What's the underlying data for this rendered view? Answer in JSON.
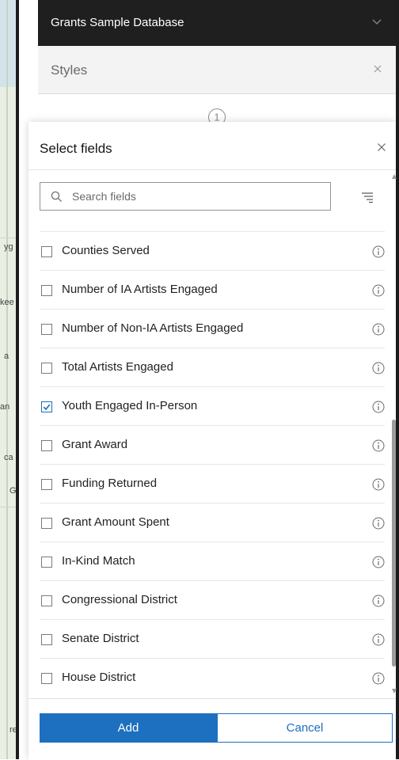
{
  "header": {
    "title": "Grants Sample Database",
    "chevron_icon": "chevron-down-icon"
  },
  "styles_panel": {
    "title": "Styles",
    "step_number": "1"
  },
  "map_labels": [
    "yg",
    "kee",
    "a",
    "an",
    "ca",
    "G",
    "re"
  ],
  "dialog": {
    "title": "Select fields",
    "search": {
      "placeholder": "Search fields",
      "value": ""
    },
    "fields": [
      {
        "label": "Counties Served",
        "checked": false
      },
      {
        "label": "Number of IA Artists Engaged",
        "checked": false
      },
      {
        "label": "Number of Non-IA Artists Engaged",
        "checked": false
      },
      {
        "label": "Total Artists Engaged",
        "checked": false
      },
      {
        "label": "Youth Engaged In-Person",
        "checked": true
      },
      {
        "label": "Grant Award",
        "checked": false
      },
      {
        "label": "Funding Returned",
        "checked": false
      },
      {
        "label": "Grant Amount Spent",
        "checked": false
      },
      {
        "label": "In-Kind Match",
        "checked": false
      },
      {
        "label": "Congressional District",
        "checked": false
      },
      {
        "label": "Senate District",
        "checked": false
      },
      {
        "label": "House District",
        "checked": false
      }
    ],
    "add_label": "Add",
    "cancel_label": "Cancel"
  },
  "colors": {
    "accent": "#1d6fbf",
    "header_bg": "#1f1f1f",
    "styles_bg": "#f3f3f3"
  }
}
